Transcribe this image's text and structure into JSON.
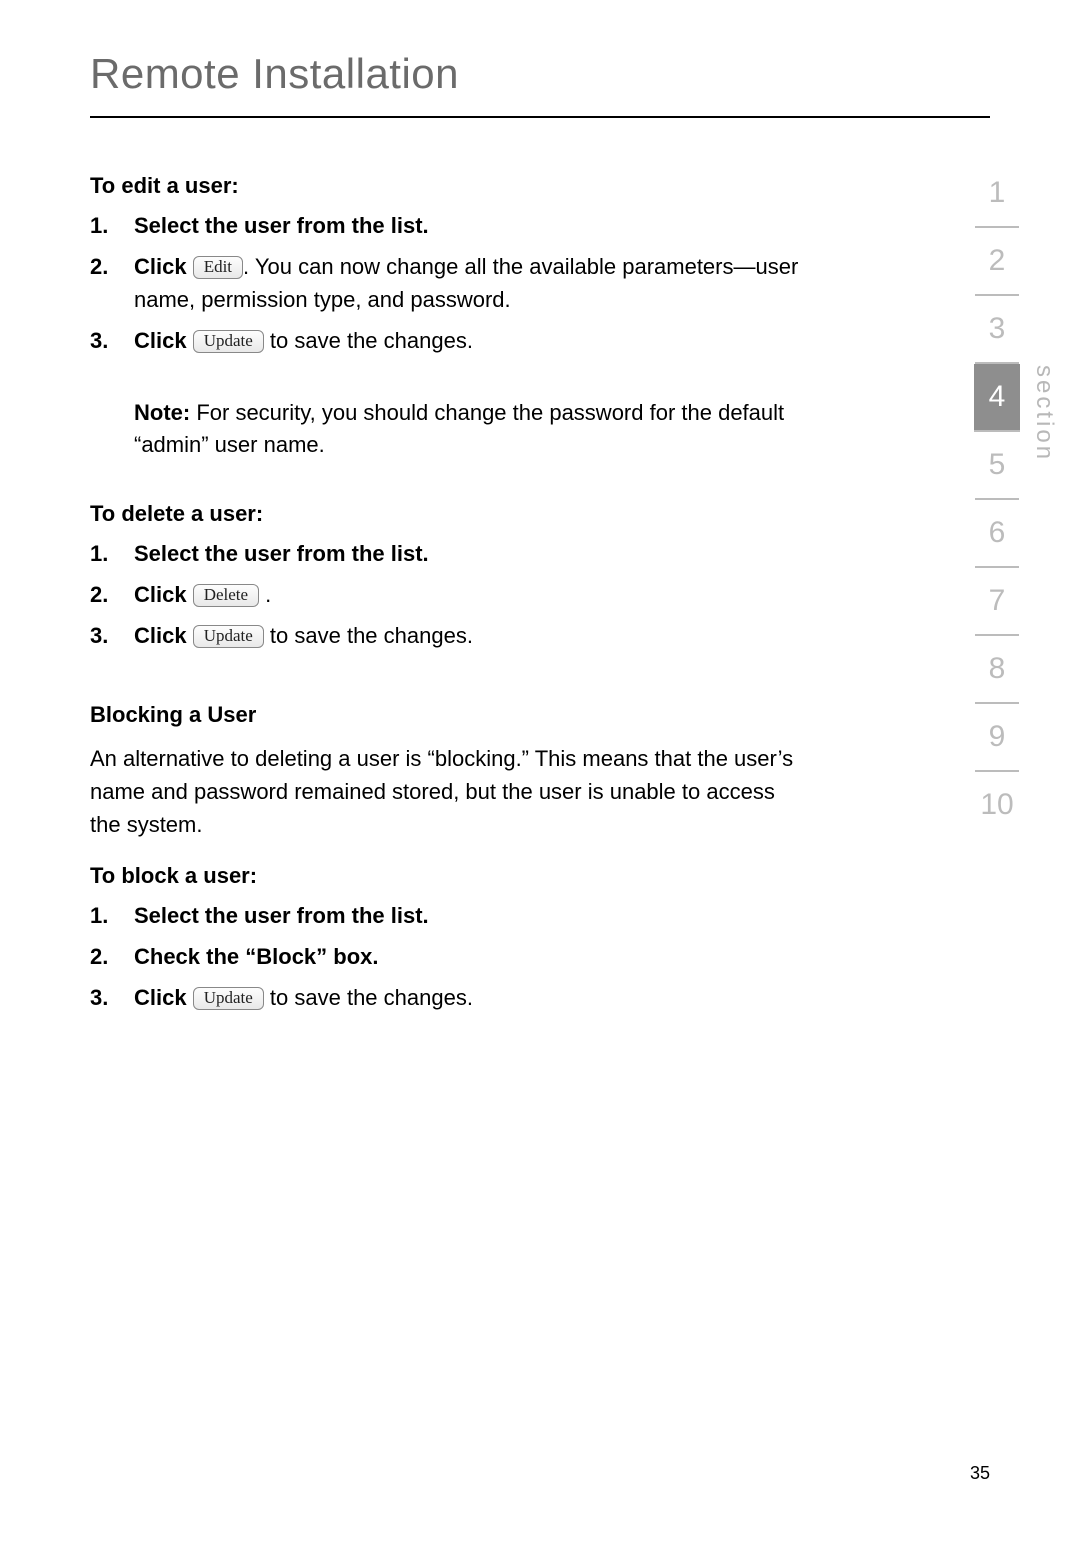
{
  "title": "Remote Installation",
  "sections": {
    "edit": {
      "heading": "To edit a user:",
      "step1": "Select the user from the list.",
      "step2_pre": "Click ",
      "step2_btn": "Edit",
      "step2_post": ". You can now change all the available parameters—user name, permission type, and password.",
      "step3_pre": "Click ",
      "step3_btn": "Update",
      "step3_post": " to save the changes.",
      "note_label": "Note:",
      "note_text": " For security, you should change the password for the default “admin” user name."
    },
    "delete": {
      "heading": "To delete a user:",
      "step1": "Select the user from the list.",
      "step2_pre": "Click ",
      "step2_btn": "Delete",
      "step2_post": " .",
      "step3_pre": "Click ",
      "step3_btn": "Update",
      "step3_post": " to save the changes."
    },
    "blocking": {
      "heading": "Blocking a User",
      "para": "An alternative to deleting a user is “blocking.” This means that the user’s name and password remained stored, but the user is unable to access the system."
    },
    "block": {
      "heading": "To block a user:",
      "step1": "Select the user from the list.",
      "step2": "Check the “Block” box.",
      "step3_pre": "Click ",
      "step3_btn": "Update",
      "step3_post": " to save the changes."
    }
  },
  "nav": {
    "label": "section",
    "items": [
      "1",
      "2",
      "3",
      "4",
      "5",
      "6",
      "7",
      "8",
      "9",
      "10"
    ],
    "active_index": 3
  },
  "page_number": "35"
}
